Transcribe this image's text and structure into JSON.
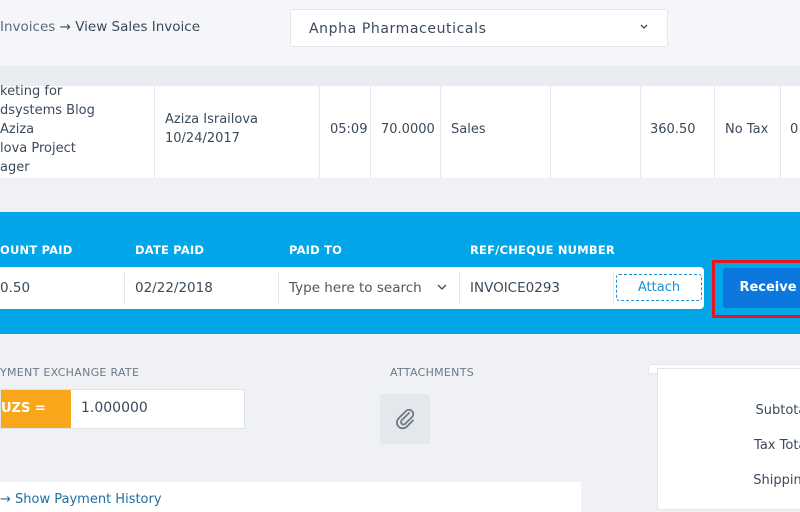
{
  "breadcrumb": {
    "parent": "Invoices",
    "arrow": "→",
    "current": "View Sales Invoice"
  },
  "company": {
    "selected": "Anpha Pharmaceuticals"
  },
  "line_item": {
    "description_lines": [
      "keting for",
      "dsystems Blog",
      "Aziza",
      "lova Project",
      "ager"
    ],
    "person": "Aziza Israilova",
    "date": "10/24/2017",
    "hours": "05:09",
    "rate": "70.0000",
    "account": "Sales",
    "amount": "360.50",
    "tax": "No Tax",
    "trailing": "0"
  },
  "payment": {
    "headers": {
      "amount_paid": "OUNT PAID",
      "date_paid": "DATE PAID",
      "paid_to": "PAID TO",
      "ref": "REF/CHEQUE NUMBER"
    },
    "amount_paid": "0.50",
    "date_paid": "02/22/2018",
    "paid_to_placeholder": "Type here to search",
    "ref_number": "INVOICE0293",
    "attach_label": "Attach",
    "receive_label": "Receive"
  },
  "exchange": {
    "label": "YMENT EXCHANGE RATE",
    "currency": "UZS =",
    "rate": "1.000000"
  },
  "attachments": {
    "label": "ATTACHMENTS"
  },
  "summary": {
    "subtotal": "Subtotal",
    "tax_total": "Tax Total",
    "shipping": "Shipping"
  },
  "history": {
    "link": "Show Payment History",
    "arrow": "→"
  }
}
